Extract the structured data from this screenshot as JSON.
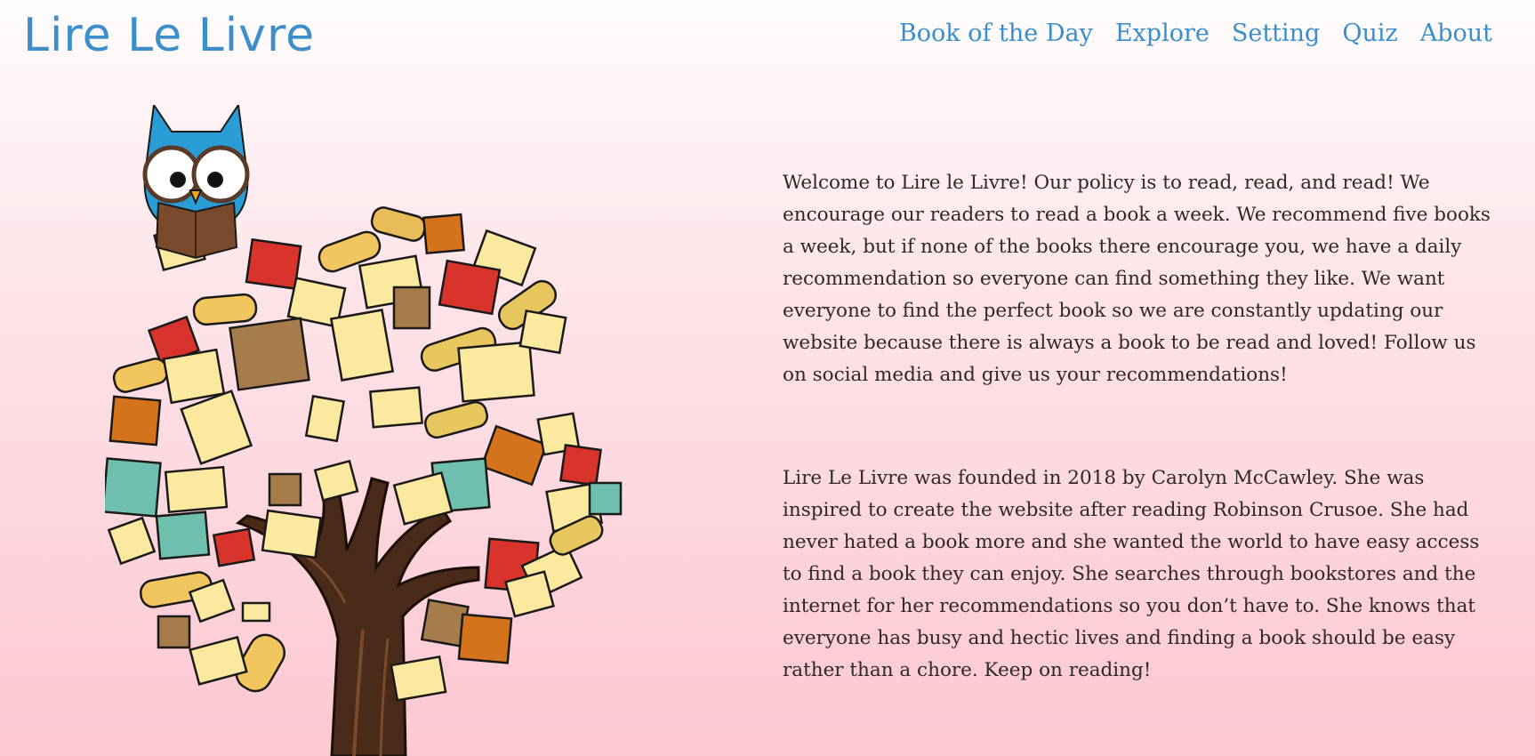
{
  "site": {
    "title": "Lire Le Livre"
  },
  "nav": {
    "items": [
      {
        "label": "Book of the Day"
      },
      {
        "label": "Explore"
      },
      {
        "label": "Setting"
      },
      {
        "label": "Quiz"
      },
      {
        "label": "About"
      }
    ]
  },
  "colors": {
    "brand_blue": "#3c8fcb",
    "background_top": "#fffdfd",
    "background_bottom": "#fcc8d2"
  },
  "main": {
    "paragraphs": [
      {
        "text": "Welcome to Lire le Livre! Our policy is to read, read, and read! We encourage our readers to read a book a week. We recommend five books a week, but if none of the books there encourage you, we have a daily recommendation so everyone can find something they like. We want everyone to find the perfect book so we are constantly updating our website because there is always a book to be read and loved! Follow us on social media and give us your recommendations!"
      },
      {
        "text": "Lire Le Livre was founded in 2018 by Carolyn McCawley. She was inspired to create the website after reading Robinson Crusoe. She had never hated a book more and she wanted the world to have easy access to find a book they can enjoy. She searches through bookstores and the internet for her recommendations so you don’t have to. She knows that everyone has busy and hectic lives and finding a book should be easy rather than a chore. Keep on reading!"
      }
    ]
  },
  "illustration": {
    "icon": "owl-book-tree-illustration"
  }
}
